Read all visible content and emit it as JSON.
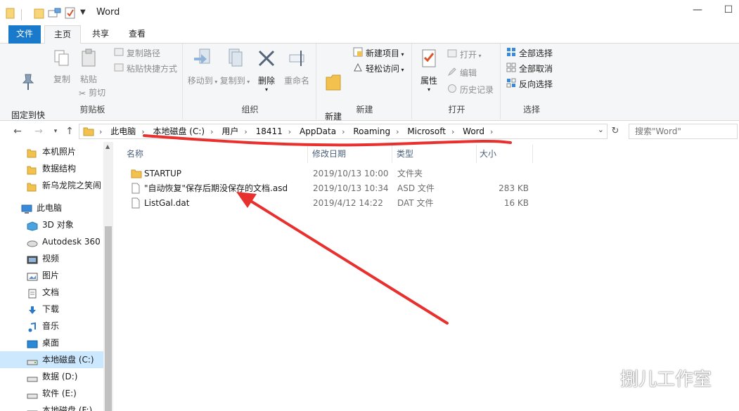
{
  "window": {
    "title": "Word",
    "controls": {
      "minimize": "—",
      "maximize": "☐"
    }
  },
  "tabs": {
    "file": "文件",
    "home": "主页",
    "share": "共享",
    "view": "查看"
  },
  "ribbon": {
    "clipboard": {
      "label": "剪贴板",
      "pin": "固定到快\n速访问",
      "copy": "复制",
      "paste": "粘贴",
      "copy_path": "复制路径",
      "paste_shortcut": "粘贴快捷方式",
      "cut": "剪切"
    },
    "organize": {
      "label": "组织",
      "move_to": "移动到",
      "copy_to": "复制到",
      "delete": "删除",
      "rename": "重命名"
    },
    "new": {
      "label": "新建",
      "new_folder": "新建\n文件夹",
      "new_item": "新建项目",
      "easy_access": "轻松访问"
    },
    "open": {
      "label": "打开",
      "properties": "属性",
      "open": "打开",
      "edit": "编辑",
      "history": "历史记录"
    },
    "select": {
      "label": "选择",
      "select_all": "全部选择",
      "select_none": "全部取消",
      "invert": "反向选择"
    }
  },
  "address": {
    "crumbs": [
      "此电脑",
      "本地磁盘 (C:)",
      "用户",
      "18411",
      "AppData",
      "Roaming",
      "Microsoft",
      "Word"
    ]
  },
  "search": {
    "placeholder": "搜索\"Word\""
  },
  "nav": {
    "items": [
      {
        "label": "本机照片",
        "icon": "folder-icon"
      },
      {
        "label": "数据结构",
        "icon": "folder-icon"
      },
      {
        "label": "新乌龙院之笑闹",
        "icon": "folder-icon"
      },
      {
        "label": "此电脑",
        "icon": "computer-icon"
      },
      {
        "label": "3D 对象",
        "icon": "3d-objects-icon"
      },
      {
        "label": "Autodesk 360",
        "icon": "cloud-icon"
      },
      {
        "label": "视频",
        "icon": "video-icon"
      },
      {
        "label": "图片",
        "icon": "pictures-icon"
      },
      {
        "label": "文档",
        "icon": "documents-icon"
      },
      {
        "label": "下载",
        "icon": "download-icon"
      },
      {
        "label": "音乐",
        "icon": "music-icon"
      },
      {
        "label": "桌面",
        "icon": "desktop-icon"
      },
      {
        "label": "本地磁盘 (C:)",
        "icon": "drive-icon"
      },
      {
        "label": "数据 (D:)",
        "icon": "drive-icon"
      },
      {
        "label": "软件 (E:)",
        "icon": "drive-icon"
      },
      {
        "label": "本地磁盘 (F:)",
        "icon": "drive-icon"
      }
    ]
  },
  "columns": {
    "name": "名称",
    "modified": "修改日期",
    "type": "类型",
    "size": "大小"
  },
  "files": [
    {
      "name": "STARTUP",
      "modified": "2019/10/13 10:00",
      "type": "文件夹",
      "size": "",
      "icon": "folder-icon"
    },
    {
      "name": "\"自动恢复\"保存后期没保存的文档.asd",
      "modified": "2019/10/13 10:34",
      "type": "ASD 文件",
      "size": "283 KB",
      "icon": "file-icon"
    },
    {
      "name": "ListGal.dat",
      "modified": "2019/4/12 14:22",
      "type": "DAT 文件",
      "size": "16 KB",
      "icon": "file-icon"
    }
  ],
  "watermark": "捌儿工作室",
  "colors": {
    "accent": "#1979ca",
    "folder": "#f2c14e",
    "annotation": "#e8312f",
    "selected": "#cce8ff"
  }
}
